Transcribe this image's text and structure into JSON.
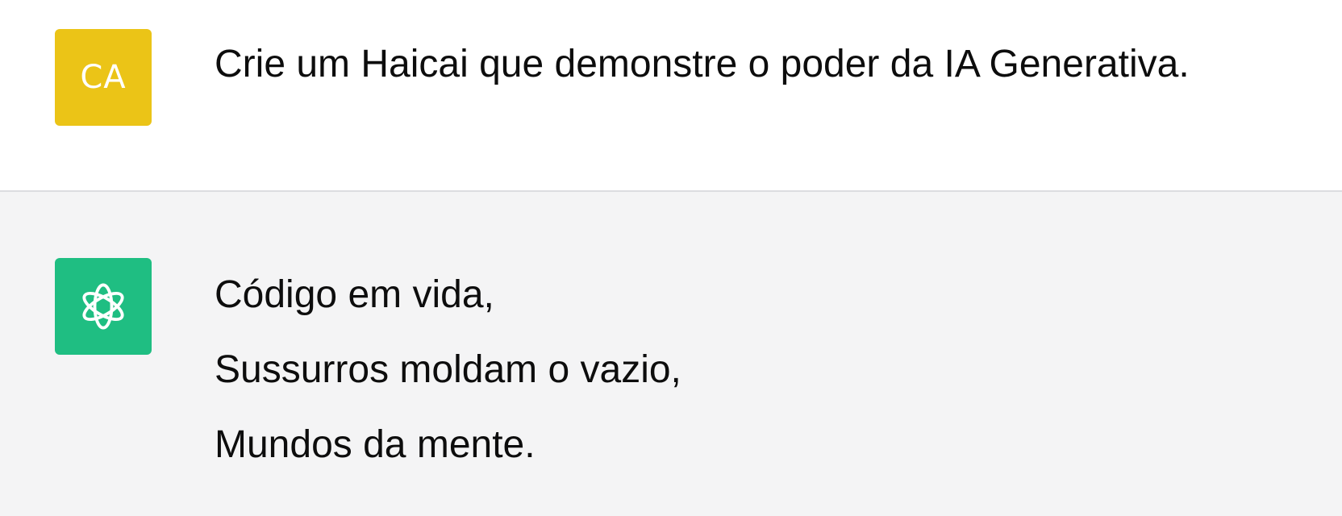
{
  "conversation": {
    "user_message": {
      "avatar_initials": "CA",
      "avatar_color": "#ebc417",
      "text": "Crie um Haicai que demonstre o poder da IA Generativa."
    },
    "assistant_message": {
      "avatar_icon": "openai-logo-icon",
      "avatar_color": "#1fbe82",
      "lines": [
        "Código em vida,",
        "Sussurros moldam o vazio,",
        "Mundos da mente."
      ]
    }
  }
}
